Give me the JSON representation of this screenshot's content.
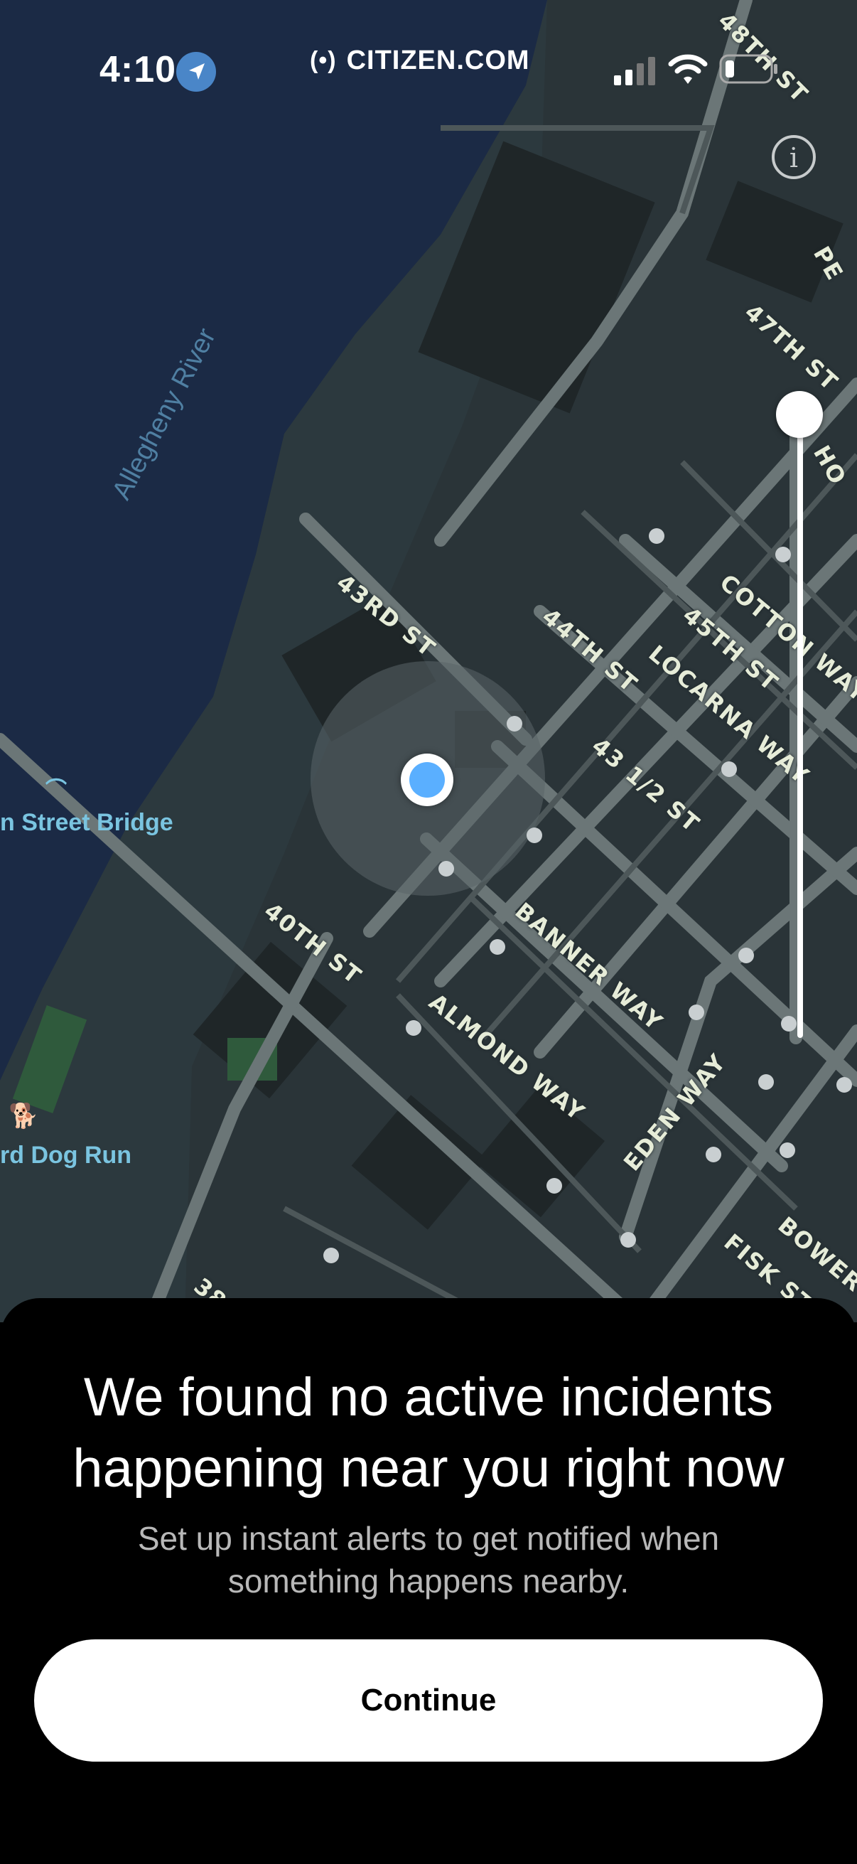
{
  "status_bar": {
    "time": "4:10",
    "brand": "CITIZEN.COM",
    "brand_mark": "(•)"
  },
  "map": {
    "info_icon": "i",
    "river_label": "Allegheny River",
    "poi_bridge": "n Street Bridge",
    "poi_dogrun": "rd Dog Run",
    "streets": {
      "s48": "48TH ST",
      "s47": "47TH ST",
      "s43": "43RD ST",
      "s44": "44TH ST",
      "s45": "45TH ST",
      "cotton": "COTTON WAY",
      "locarna": "LOCARNA WAY",
      "s43h": "43 1/2 ST",
      "banner": "BANNER WAY",
      "s40": "40TH ST",
      "almond": "ALMOND WAY",
      "eden": "EDEN WAY",
      "fisk": "FISK ST",
      "bower": "BOWER",
      "s38": "38",
      "ho": "HO",
      "pe": "PE"
    },
    "radius_slider_level": 0
  },
  "sheet": {
    "title_line1": "We found no active incidents",
    "title_line2": "happening near you right now",
    "subtitle_line1": "Set up instant alerts to get notified when",
    "subtitle_line2": "something happens nearby.",
    "continue_label": "Continue"
  },
  "colors": {
    "map_land": "#2a3438",
    "map_water": "#1b2a45",
    "road": "#6b7677",
    "accent_blue": "#5aafff"
  }
}
